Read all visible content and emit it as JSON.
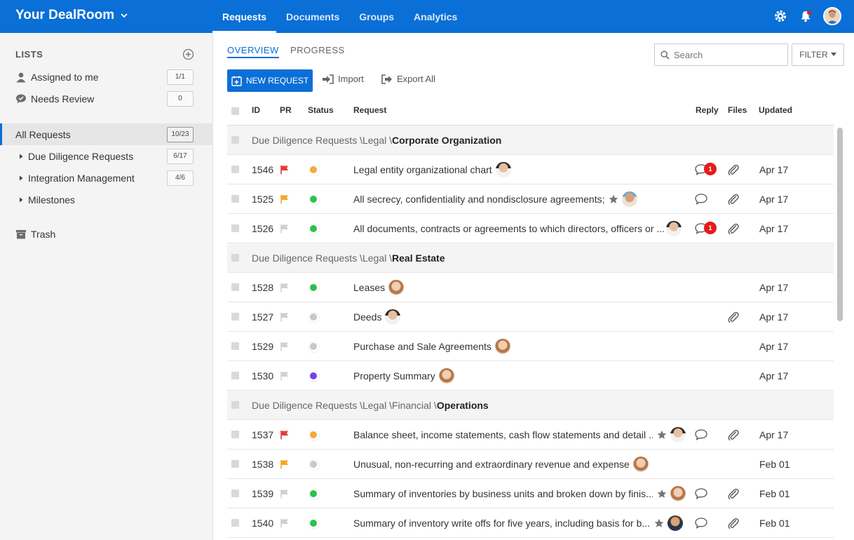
{
  "app": {
    "title": "Your DealRoom"
  },
  "nav": {
    "items": [
      {
        "label": "Requests",
        "active": true
      },
      {
        "label": "Documents",
        "active": false
      },
      {
        "label": "Groups",
        "active": false
      },
      {
        "label": "Analytics",
        "active": false
      }
    ]
  },
  "topIcons": [
    "gear-icon",
    "bell-icon",
    "user-avatar"
  ],
  "sidebar": {
    "heading": "LISTS",
    "items": [
      {
        "label": "Assigned to me",
        "count": "1/1",
        "icon": "person-icon"
      },
      {
        "label": "Needs Review",
        "count": "0",
        "icon": "check-bubble-icon"
      },
      {
        "label": "All Requests",
        "count": "10/23",
        "selected": true
      },
      {
        "label": "Due Diligence Requests",
        "count": "6/17",
        "caret": true
      },
      {
        "label": "Integration Management",
        "count": "4/6",
        "caret": true
      },
      {
        "label": "Milestones",
        "count": "",
        "caret": true
      },
      {
        "label": "Trash",
        "count": "",
        "icon": "archive-icon"
      }
    ]
  },
  "main": {
    "subtabs": [
      {
        "label": "OVERVIEW",
        "active": true
      },
      {
        "label": "PROGRESS",
        "active": false
      }
    ],
    "search": {
      "placeholder": "Search"
    },
    "filter_label": "FILTER",
    "new_request_label": "NEW REQUEST",
    "import_label": "Import",
    "export_label": "Export All",
    "columns": {
      "id": "ID",
      "pr": "PR",
      "status": "Status",
      "request": "Request",
      "reply": "Reply",
      "files": "Files",
      "updated": "Updated"
    },
    "colors": {
      "accent": "#0a6fd6",
      "flag_red": "#e33b3b",
      "flag_orange": "#f5a623",
      "flag_gray": "#d0d0d0",
      "status_green": "#2bc14b",
      "status_orange": "#f6a938",
      "status_gray": "#c4c8cf",
      "status_purple": "#7b3fe4",
      "badge": "#e51b1b"
    },
    "rows": [
      {
        "type": "group",
        "path": "Due Diligence Requests \\Legal \\",
        "bold": "Corporate Organization"
      },
      {
        "type": "item",
        "id": "1546",
        "flag": "red",
        "status": "orange",
        "request": "Legal entity organizational chart",
        "star": false,
        "avatar": "man1",
        "reply": true,
        "badge": "1",
        "files": true,
        "updated": "Apr 17"
      },
      {
        "type": "item",
        "id": "1525",
        "flag": "orange",
        "status": "green",
        "request": "All secrecy, confidentiality and nondisclosure agreements;",
        "star": true,
        "avatar": "man2",
        "reply": true,
        "badge": "",
        "files": true,
        "updated": "Apr 17"
      },
      {
        "type": "item",
        "id": "1526",
        "flag": "gray",
        "status": "green",
        "request": "All documents, contracts or agreements to which directors, officers or ...",
        "star": false,
        "avatar": "man1",
        "avatarSide": true,
        "reply": true,
        "badge": "1",
        "files": true,
        "updated": "Apr 17"
      },
      {
        "type": "group",
        "path": "Due Diligence Requests \\Legal \\",
        "bold": "Real Estate"
      },
      {
        "type": "item",
        "id": "1528",
        "flag": "gray",
        "status": "green",
        "request": "Leases",
        "star": false,
        "avatar": "woman",
        "reply": false,
        "badge": "",
        "files": false,
        "updated": "Apr 17"
      },
      {
        "type": "item",
        "id": "1527",
        "flag": "gray",
        "status": "gray",
        "request": "Deeds",
        "star": false,
        "avatar": "man1",
        "reply": false,
        "badge": "",
        "files": true,
        "updated": "Apr 17"
      },
      {
        "type": "item",
        "id": "1529",
        "flag": "gray",
        "status": "gray",
        "request": "Purchase and Sale Agreements",
        "star": false,
        "avatar": "woman",
        "reply": false,
        "badge": "",
        "files": false,
        "updated": "Apr 17"
      },
      {
        "type": "item",
        "id": "1530",
        "flag": "gray",
        "status": "purple",
        "request": "Property Summary",
        "star": false,
        "avatar": "woman",
        "reply": false,
        "badge": "",
        "files": false,
        "updated": "Apr 17"
      },
      {
        "type": "group",
        "path": "Due Diligence Requests \\Legal \\Financial \\",
        "bold": "Operations"
      },
      {
        "type": "item",
        "id": "1537",
        "flag": "red",
        "status": "orange",
        "request": "Balance sheet, income statements, cash flow statements and detail ...",
        "star": true,
        "avatar": "man1",
        "reply": true,
        "badge": "",
        "files": true,
        "updated": "Apr 17"
      },
      {
        "type": "item",
        "id": "1538",
        "flag": "orange",
        "status": "gray",
        "request": "Unusual, non-recurring and extraordinary revenue and expense",
        "star": false,
        "avatar": "woman",
        "reply": false,
        "badge": "",
        "files": false,
        "updated": "Feb 01"
      },
      {
        "type": "item",
        "id": "1539",
        "flag": "gray",
        "status": "green",
        "request": "Summary of inventories by business units and broken down by finis...",
        "star": true,
        "avatar": "woman",
        "reply": true,
        "badge": "",
        "files": true,
        "updated": "Feb 01"
      },
      {
        "type": "item",
        "id": "1540",
        "flag": "gray",
        "status": "green",
        "request": "Summary of inventory write offs for five years, including basis for b...",
        "star": true,
        "avatar": "man3",
        "reply": true,
        "badge": "",
        "files": true,
        "updated": "Feb 01"
      }
    ]
  }
}
